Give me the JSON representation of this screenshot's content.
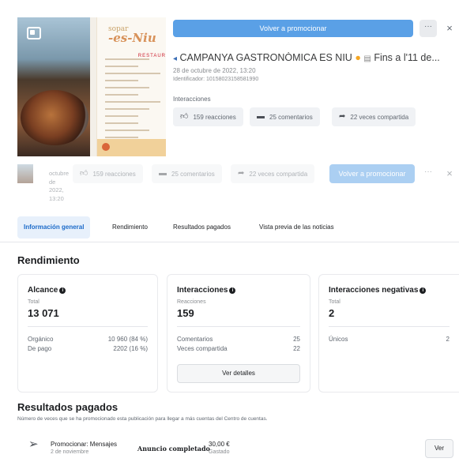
{
  "post": {
    "promote_button": "Volver a promocionar",
    "more_label": "···",
    "close_label": "×",
    "title_prefix_icons": "◂",
    "title": "CAMPANYA GASTRONÒMICA ES NIU",
    "title_suffix": "Fins a l'11 de...",
    "date": "28 de octubre de 2022, 13:20",
    "identifier": "Identificador: 10158023158581990",
    "interactions_label": "Interacciones",
    "reactions": "159 reacciones",
    "comments": "25 comentarios",
    "shares": "22 veces compartida",
    "thumbnail": {
      "brand_small": "sopar",
      "brand_big": "-es-Niu",
      "menu_tag": "RESTAUR"
    }
  },
  "sticky": {
    "date_lines": [
      "octubre",
      "de",
      "2022,",
      "13:20"
    ],
    "reactions": "159 reacciones",
    "comments": "25 comentarios",
    "shares": "22 veces compartida",
    "promote_button": "Volver a promocionar",
    "more_label": "···",
    "close_label": "×"
  },
  "tabs": [
    {
      "label": "Información general",
      "active": true
    },
    {
      "label": "Rendimiento",
      "active": false
    },
    {
      "label": "Resultados pagados",
      "active": false
    },
    {
      "label": "Vista previa de las noticias",
      "active": false
    }
  ],
  "performance": {
    "section_title": "Rendimiento",
    "reach": {
      "title": "Alcance",
      "sub": "Total",
      "value": "13 071",
      "rows": [
        {
          "label": "Orgánico",
          "value": "10 960 (84 %)"
        },
        {
          "label": "De pago",
          "value": "2202 (16 %)"
        }
      ]
    },
    "interactions": {
      "title": "Interacciones",
      "sub": "Reacciones",
      "value": "159",
      "rows": [
        {
          "label": "Comentarios",
          "value": "25"
        },
        {
          "label": "Veces compartida",
          "value": "22"
        }
      ],
      "details_button": "Ver detalles"
    },
    "negative": {
      "title": "Interacciones negativas",
      "sub": "Total",
      "value": "2",
      "rows": [
        {
          "label": "Únicos",
          "value": "2"
        }
      ]
    }
  },
  "paid": {
    "section_title": "Resultados pagados",
    "description": "Número de veces que se ha promocionado esta publicación para llegar a más cuentas del Centro de cuentas.",
    "rows": [
      {
        "name": "Promocionar: Mensajes",
        "date": "2 de noviembre",
        "status": "Anuncio completado",
        "amount": "30,00 €",
        "amount_label": "Gastado",
        "view_button": "Ver"
      }
    ]
  },
  "colors": {
    "primary": "#5aa0e6",
    "active_tab_bg": "#e7f0fb",
    "active_tab_text": "#1b6ac9"
  }
}
